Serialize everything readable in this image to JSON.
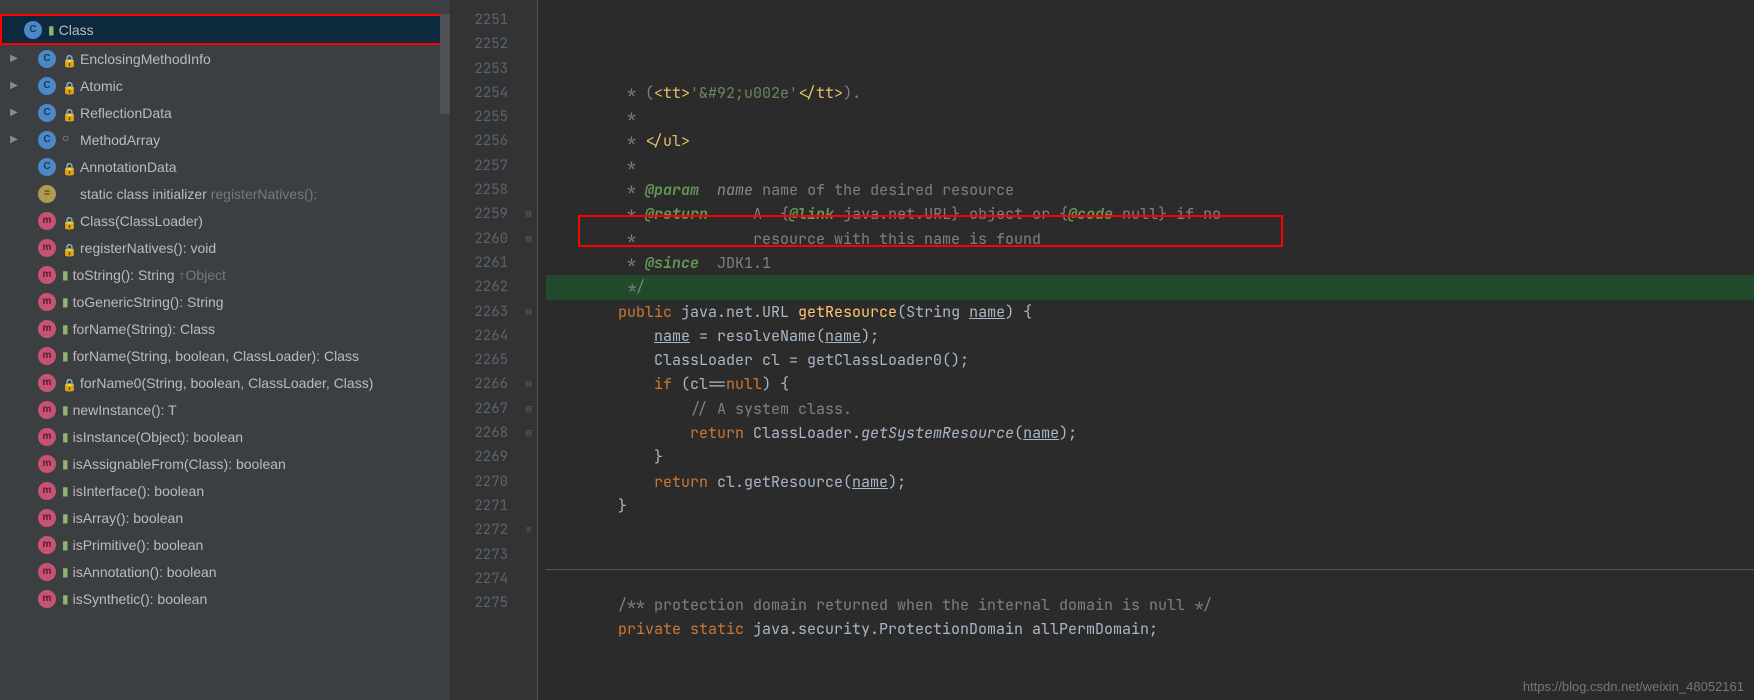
{
  "sidebar": {
    "items": [
      {
        "expand": "",
        "icon": "C",
        "iconCls": "icon-c",
        "mod": "folder",
        "label": "Class",
        "hint": "",
        "selected": true
      },
      {
        "expand": "▶",
        "icon": "C",
        "iconCls": "icon-c",
        "mod": "lock",
        "label": "EnclosingMethodInfo",
        "hint": ""
      },
      {
        "expand": "▶",
        "icon": "C",
        "iconCls": "icon-c",
        "mod": "lock",
        "label": "Atomic",
        "hint": ""
      },
      {
        "expand": "▶",
        "icon": "C",
        "iconCls": "icon-c",
        "mod": "lock",
        "label": "ReflectionData",
        "hint": ""
      },
      {
        "expand": "▶",
        "icon": "C",
        "iconCls": "icon-c",
        "mod": "open",
        "label": "MethodArray",
        "hint": ""
      },
      {
        "expand": "",
        "icon": "C",
        "iconCls": "icon-c",
        "mod": "lock",
        "label": "AnnotationData",
        "hint": ""
      },
      {
        "expand": "",
        "icon": "=",
        "iconCls": "icon-c yellow",
        "mod": "",
        "label": "static class initializer ",
        "hint": "registerNatives();"
      },
      {
        "expand": "",
        "icon": "m",
        "iconCls": "icon-c magenta",
        "mod": "lock",
        "label": "Class(ClassLoader)",
        "hint": ""
      },
      {
        "expand": "",
        "icon": "m",
        "iconCls": "icon-c magenta",
        "mod": "lock",
        "label": "registerNatives(): void",
        "hint": ""
      },
      {
        "expand": "",
        "icon": "m",
        "iconCls": "icon-c magenta",
        "mod": "green",
        "label": "toString(): String ",
        "hint": "↑Object"
      },
      {
        "expand": "",
        "icon": "m",
        "iconCls": "icon-c magenta",
        "mod": "green",
        "label": "toGenericString(): String",
        "hint": ""
      },
      {
        "expand": "",
        "icon": "m",
        "iconCls": "icon-c magenta",
        "mod": "green",
        "label": "forName(String): Class<?>",
        "hint": ""
      },
      {
        "expand": "",
        "icon": "m",
        "iconCls": "icon-c magenta",
        "mod": "green",
        "label": "forName(String, boolean, ClassLoader): Class<?>",
        "hint": ""
      },
      {
        "expand": "",
        "icon": "m",
        "iconCls": "icon-c magenta",
        "mod": "lock",
        "label": "forName0(String, boolean, ClassLoader, Class<?>)",
        "hint": ""
      },
      {
        "expand": "",
        "icon": "m",
        "iconCls": "icon-c magenta",
        "mod": "green",
        "label": "newInstance(): T",
        "hint": ""
      },
      {
        "expand": "",
        "icon": "m",
        "iconCls": "icon-c magenta",
        "mod": "green",
        "label": "isInstance(Object): boolean",
        "hint": ""
      },
      {
        "expand": "",
        "icon": "m",
        "iconCls": "icon-c magenta",
        "mod": "green",
        "label": "isAssignableFrom(Class<?>): boolean",
        "hint": ""
      },
      {
        "expand": "",
        "icon": "m",
        "iconCls": "icon-c magenta",
        "mod": "green",
        "label": "isInterface(): boolean",
        "hint": ""
      },
      {
        "expand": "",
        "icon": "m",
        "iconCls": "icon-c magenta",
        "mod": "green",
        "label": "isArray(): boolean",
        "hint": ""
      },
      {
        "expand": "",
        "icon": "m",
        "iconCls": "icon-c magenta",
        "mod": "green",
        "label": "isPrimitive(): boolean",
        "hint": ""
      },
      {
        "expand": "",
        "icon": "m",
        "iconCls": "icon-c magenta",
        "mod": "green",
        "label": "isAnnotation(): boolean",
        "hint": ""
      },
      {
        "expand": "",
        "icon": "m",
        "iconCls": "icon-c magenta",
        "mod": "green",
        "label": "isSynthetic(): boolean",
        "hint": ""
      }
    ]
  },
  "editor": {
    "lineStart": 2251,
    "lines": [
      {
        "html": "         * (<span class='c-tag'>&lt;tt&gt;</span><span class='c-string'>'&amp;#92;u002e'</span><span class='c-tag'>&lt;/tt&gt;</span>)."
      },
      {
        "html": "         *"
      },
      {
        "html": "         * <span class='c-tag'>&lt;/ul&gt;</span>"
      },
      {
        "html": "         *"
      },
      {
        "html": "         * <span class='c-doctag'>@param</span>  <span class='c-docparam'>name</span> name of the desired resource"
      },
      {
        "html": "         * <span class='c-doctag'>@return</span>     A  {<span class='c-doctag'>@link</span> java.net.URL} object or {<span class='c-doctag'>@code</span> null} if no"
      },
      {
        "html": "         *             resource with this name is found"
      },
      {
        "html": "         * <span class='c-doctag'>@since</span>  JDK1.1"
      },
      {
        "html": "         */",
        "hl": true
      },
      {
        "html": "        <span class='c-keyword'>public</span> java.net.URL <span class='c-method'>getResource</span>(String <span class='c-underline'>name</span>) {"
      },
      {
        "html": "            <span class='c-underline'>name</span> = resolveName(<span class='c-underline'>name</span>);"
      },
      {
        "html": "            ClassLoader cl = getClassLoader0();"
      },
      {
        "html": "            <span class='c-keyword'>if</span> (cl==<span class='c-keyword'>null</span>) {"
      },
      {
        "html": "                <span class='c-comment'>// A system class.</span>"
      },
      {
        "html": "                <span class='c-keyword'>return</span> ClassLoader.<span class='c-static'>getSystemResource</span>(<span class='c-underline'>name</span>);"
      },
      {
        "html": "            }"
      },
      {
        "html": "            <span class='c-keyword'>return</span> cl.getResource(<span class='c-underline'>name</span>);"
      },
      {
        "html": "        }"
      },
      {
        "html": ""
      },
      {
        "html": ""
      },
      {
        "html": "",
        "sep": true
      },
      {
        "html": "        <span class='c-comment'>/** protection domain returned when the internal domain is null */</span>"
      },
      {
        "html": "        <span class='c-keyword'>private static</span> java.security.ProtectionDomain allPermDomain;"
      },
      {
        "html": ""
      },
      {
        "html": ""
      }
    ],
    "foldMarks": {
      "2259": "⊟",
      "2260": "⊟",
      "2263": "⊟",
      "2266": "⊟",
      "2267": "⊟",
      "2268": "⊟",
      "2272": "≡"
    }
  },
  "watermark": "https://blog.csdn.net/weixin_48052161"
}
